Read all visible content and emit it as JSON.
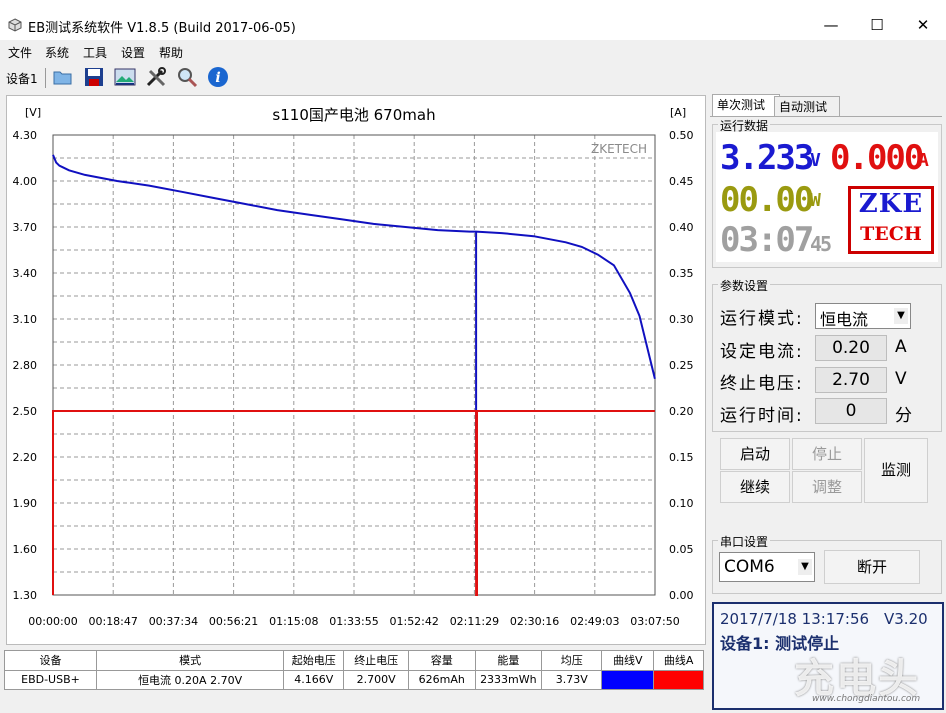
{
  "window": {
    "title": "EB测试系统软件 V1.8.5 (Build 2017-06-05)",
    "min_icon": "minimize-icon",
    "max_icon": "maximize-icon",
    "close_icon": "close-icon"
  },
  "menu": [
    "文件",
    "系统",
    "工具",
    "设置",
    "帮助"
  ],
  "toolbar": {
    "device_tab": "设备1",
    "icons": [
      "folder-icon",
      "save-icon",
      "image-icon",
      "tools-icon",
      "magnifier-icon",
      "info-icon"
    ]
  },
  "chart": {
    "watermark": "ZKETECH",
    "left_unit": "[V]",
    "right_unit": "[A]",
    "title": "s110国产电池 670mah",
    "y_left_ticks": [
      "4.30",
      "4.00",
      "3.70",
      "3.40",
      "3.10",
      "2.80",
      "2.50",
      "2.20",
      "1.90",
      "1.60",
      "1.30"
    ],
    "y_right_ticks": [
      "0.50",
      "0.45",
      "0.40",
      "0.35",
      "0.30",
      "0.25",
      "0.20",
      "0.15",
      "0.10",
      "0.05",
      "0.00"
    ],
    "x_ticks": [
      "00:00:00",
      "00:18:47",
      "00:37:34",
      "00:56:21",
      "01:15:08",
      "01:33:55",
      "01:52:42",
      "02:11:29",
      "02:30:16",
      "02:49:03",
      "03:07:50"
    ]
  },
  "chart_data": {
    "type": "line",
    "title": "s110国产电池 670mah",
    "xlabel": "",
    "ylabel": "[V]",
    "y2label": "[A]",
    "x_ticks": [
      "00:00:00",
      "00:18:47",
      "00:37:34",
      "00:56:21",
      "01:15:08",
      "01:33:55",
      "01:52:42",
      "02:11:29",
      "02:30:16",
      "02:49:03",
      "03:07:50"
    ],
    "xlim": [
      "00:00:00",
      "03:07:50"
    ],
    "ylim": [
      1.3,
      4.3
    ],
    "y2lim": [
      0,
      0.5
    ],
    "grid": true,
    "series": [
      {
        "axis": "left",
        "color": "#1010c0",
        "x_min": [
          0,
          1,
          2,
          3,
          5,
          10,
          20,
          30,
          40,
          50,
          60,
          70,
          80,
          90,
          100,
          110,
          120,
          130,
          132,
          140,
          150,
          160,
          165,
          170,
          175,
          180,
          183,
          187.8
        ],
        "values": [
          4.17,
          4.12,
          4.1,
          4.09,
          4.07,
          4.04,
          4.0,
          3.97,
          3.93,
          3.89,
          3.85,
          3.81,
          3.78,
          3.75,
          3.72,
          3.7,
          3.68,
          3.67,
          3.67,
          3.66,
          3.64,
          3.6,
          3.57,
          3.52,
          3.45,
          3.27,
          3.12,
          2.71
        ]
      },
      {
        "axis": "left",
        "color": "#1010c0",
        "note_type": "drop",
        "x_min": [
          132,
          132
        ],
        "values": [
          3.67,
          1.4
        ]
      },
      {
        "axis": "right",
        "color": "#e01010",
        "x_min": [
          0,
          0,
          0.4,
          132,
          132,
          132.3,
          132.3,
          187.8
        ],
        "values": [
          0,
          0.2,
          0.2,
          0.2,
          0.0,
          0.0,
          0.2,
          0.2
        ]
      }
    ]
  },
  "table": {
    "headers": [
      "设备",
      "模式",
      "起始电压",
      "终止电压",
      "容量",
      "能量",
      "均压",
      "曲线V",
      "曲线A"
    ],
    "row": [
      "EBD-USB+",
      "恒电流  0.20A  2.70V",
      "4.166V",
      "2.700V",
      "626mAh",
      "2333mWh",
      "3.73V",
      "",
      ""
    ],
    "curve_v_color": "#0000ff",
    "curve_a_color": "#ff0000"
  },
  "tabs": [
    "单次测试",
    "自动测试"
  ],
  "run_data": {
    "label": "运行数据",
    "voltage": "3.233",
    "voltage_unit": "V",
    "current": "0.000",
    "current_unit": "A",
    "power": "00.00",
    "power_unit": "W",
    "time": "03:07",
    "time_sec": "45",
    "logo_top": "ZKE",
    "logo_bottom": "TECH",
    "colors": {
      "voltage": "#1a1ad0",
      "current": "#e01010",
      "power": "#9a9a10",
      "time": "#a0a0a0"
    }
  },
  "params": {
    "label": "参数设置",
    "mode_label": "运行模式:",
    "mode_value": "恒电流",
    "current_label": "设定电流:",
    "current_value": "0.20",
    "current_unit": "A",
    "voltage_label": "终止电压:",
    "voltage_value": "2.70",
    "voltage_unit": "V",
    "time_label": "运行时间:",
    "time_value": "0",
    "time_unit": "分"
  },
  "buttons": {
    "start": "启动",
    "stop": "停止",
    "continue": "继续",
    "adjust": "调整",
    "monitor": "监测"
  },
  "serial": {
    "label": "串口设置",
    "port": "COM6",
    "disconnect": "断开"
  },
  "status": {
    "datetime": "2017/7/18 13:17:56",
    "version": "V3.20",
    "message": "设备1: 测试停止"
  },
  "corner_watermark": {
    "main": "充电头",
    "sub": "www.chongdiantou.com"
  }
}
